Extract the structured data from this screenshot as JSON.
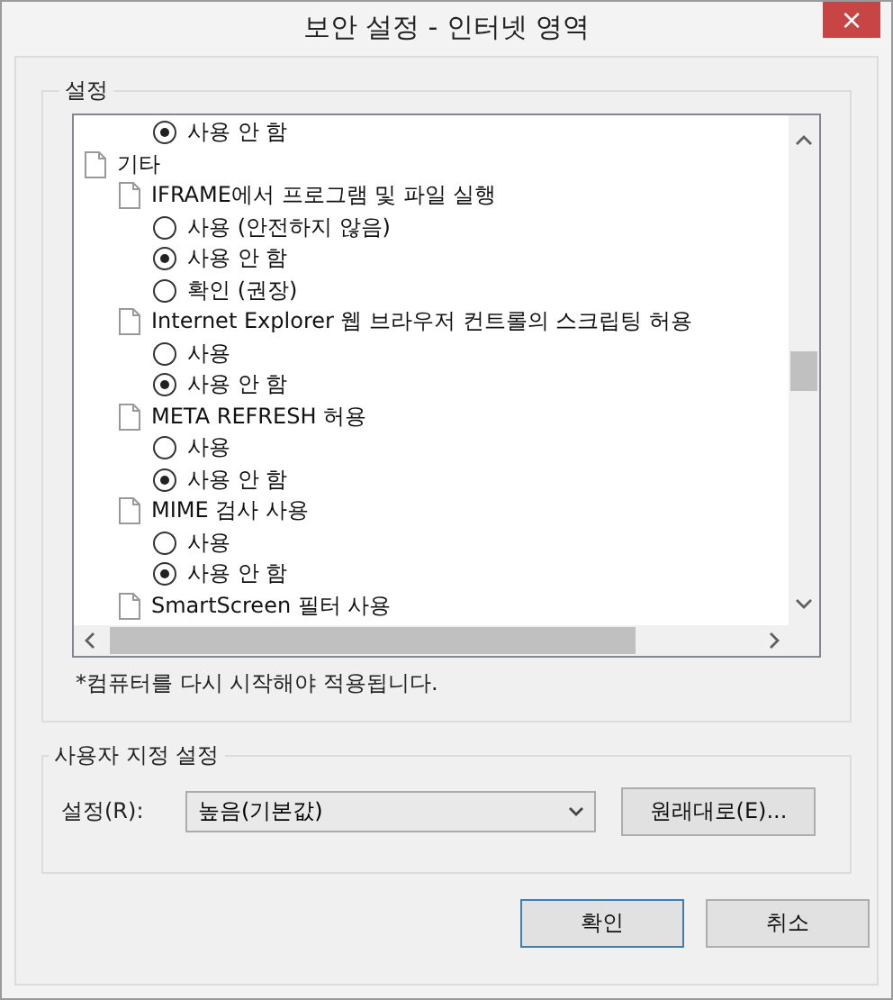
{
  "window": {
    "title": "보안 설정 - 인터넷 영역",
    "close": "×"
  },
  "settings_group": {
    "title": "설정",
    "tree": {
      "continued_options": [
        {
          "label": "사용 안 함",
          "selected": true
        }
      ],
      "items": [
        {
          "label": "기타",
          "children": [
            {
              "label": "IFRAME에서 프로그램 및 파일 실행",
              "options": [
                {
                  "label": "사용 (안전하지 않음)",
                  "selected": false
                },
                {
                  "label": "사용 안 함",
                  "selected": true
                },
                {
                  "label": "확인 (권장)",
                  "selected": false
                }
              ]
            },
            {
              "label": "Internet Explorer 웹 브라우저 컨트롤의 스크립팅 허용",
              "options": [
                {
                  "label": "사용",
                  "selected": false
                },
                {
                  "label": "사용 안 함",
                  "selected": true
                }
              ]
            },
            {
              "label": "META REFRESH 허용",
              "options": [
                {
                  "label": "사용",
                  "selected": false
                },
                {
                  "label": "사용 안 함",
                  "selected": true
                }
              ]
            },
            {
              "label": "MIME 검사 사용",
              "options": [
                {
                  "label": "사용",
                  "selected": false
                },
                {
                  "label": "사용 안 함",
                  "selected": true
                }
              ]
            },
            {
              "label": "SmartScreen 필터 사용"
            }
          ]
        }
      ]
    },
    "note": "*컴퓨터를 다시 시작해야 적용됩니다."
  },
  "custom_group": {
    "title": "사용자 지정 설정",
    "label": "설정(R):",
    "select_value": "높음(기본값)",
    "reset_button": "원래대로(E)..."
  },
  "buttons": [
    {
      "label": "확인",
      "default": true
    },
    {
      "label": "취소",
      "default": false
    }
  ]
}
